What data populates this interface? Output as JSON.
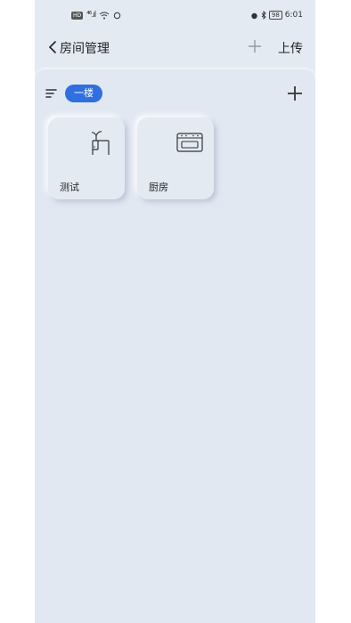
{
  "status_bar": {
    "left_badge": "HD",
    "signal": "⁴⁶.ıl",
    "right_battery": "98",
    "time": "6:01"
  },
  "header": {
    "title": "房间管理",
    "upload_label": "上传"
  },
  "floor": {
    "selected_tab": "一楼"
  },
  "rooms": [
    {
      "name": "测试",
      "icon": "desk-plant-icon"
    },
    {
      "name": "厨房",
      "icon": "stove-icon"
    }
  ]
}
